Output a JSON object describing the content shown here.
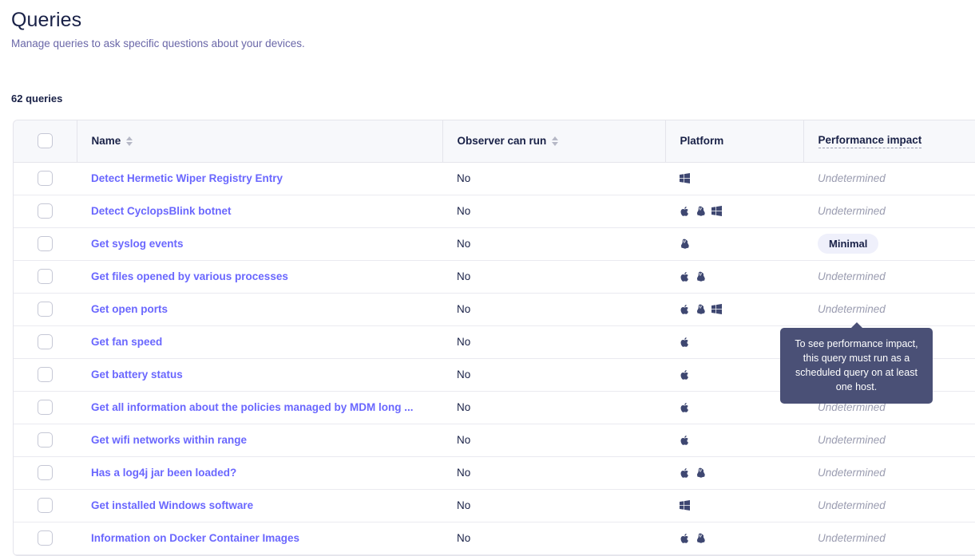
{
  "page": {
    "title": "Queries",
    "subtitle": "Manage queries to ask specific questions about your devices.",
    "count_label": "62 queries"
  },
  "table": {
    "columns": {
      "select_all": "",
      "name": "Name",
      "observer_can_run": "Observer can run",
      "platform": "Platform",
      "performance_impact": "Performance impact"
    },
    "rows": [
      {
        "name": "Detect Hermetic Wiper Registry Entry",
        "observer_can_run": "No",
        "platforms": [
          "windows"
        ],
        "performance_impact": "Undetermined",
        "impact_type": "text"
      },
      {
        "name": "Detect CyclopsBlink botnet",
        "observer_can_run": "No",
        "platforms": [
          "apple",
          "linux",
          "windows"
        ],
        "performance_impact": "Undetermined",
        "impact_type": "text"
      },
      {
        "name": "Get syslog events",
        "observer_can_run": "No",
        "platforms": [
          "linux"
        ],
        "performance_impact": "Minimal",
        "impact_type": "badge"
      },
      {
        "name": "Get files opened by various processes",
        "observer_can_run": "No",
        "platforms": [
          "apple",
          "linux"
        ],
        "performance_impact": "Undetermined",
        "impact_type": "text"
      },
      {
        "name": "Get open ports",
        "observer_can_run": "No",
        "platforms": [
          "apple",
          "linux",
          "windows"
        ],
        "performance_impact": "Undetermined",
        "impact_type": "text"
      },
      {
        "name": "Get fan speed",
        "observer_can_run": "No",
        "platforms": [
          "apple"
        ],
        "performance_impact": "",
        "impact_type": "none"
      },
      {
        "name": "Get battery status",
        "observer_can_run": "No",
        "platforms": [
          "apple"
        ],
        "performance_impact": "",
        "impact_type": "none"
      },
      {
        "name": "Get all information about the policies managed by MDM long ...",
        "observer_can_run": "No",
        "platforms": [
          "apple"
        ],
        "performance_impact": "Undetermined",
        "impact_type": "text"
      },
      {
        "name": "Get wifi networks within range",
        "observer_can_run": "No",
        "platforms": [
          "apple"
        ],
        "performance_impact": "Undetermined",
        "impact_type": "text"
      },
      {
        "name": "Has a log4j jar been loaded?",
        "observer_can_run": "No",
        "platforms": [
          "apple",
          "linux"
        ],
        "performance_impact": "Undetermined",
        "impact_type": "text"
      },
      {
        "name": "Get installed Windows software",
        "observer_can_run": "No",
        "platforms": [
          "windows"
        ],
        "performance_impact": "Undetermined",
        "impact_type": "text"
      },
      {
        "name": "Information on Docker Container Images",
        "observer_can_run": "No",
        "platforms": [
          "apple",
          "linux"
        ],
        "performance_impact": "Undetermined",
        "impact_type": "text"
      }
    ]
  },
  "tooltip": {
    "text": "To see performance impact, this query must run as a scheduled query on at least one host."
  },
  "colors": {
    "link": "#6a67fe",
    "heading": "#192147",
    "muted": "#9a9cb0",
    "tooltip_bg": "#4a5076",
    "badge_bg": "#eff0fb",
    "icon": "#3e4771"
  },
  "icons": {
    "sort": "sort-icon",
    "apple": "apple-icon",
    "linux": "linux-icon",
    "windows": "windows-icon",
    "checkbox": "checkbox-icon"
  }
}
